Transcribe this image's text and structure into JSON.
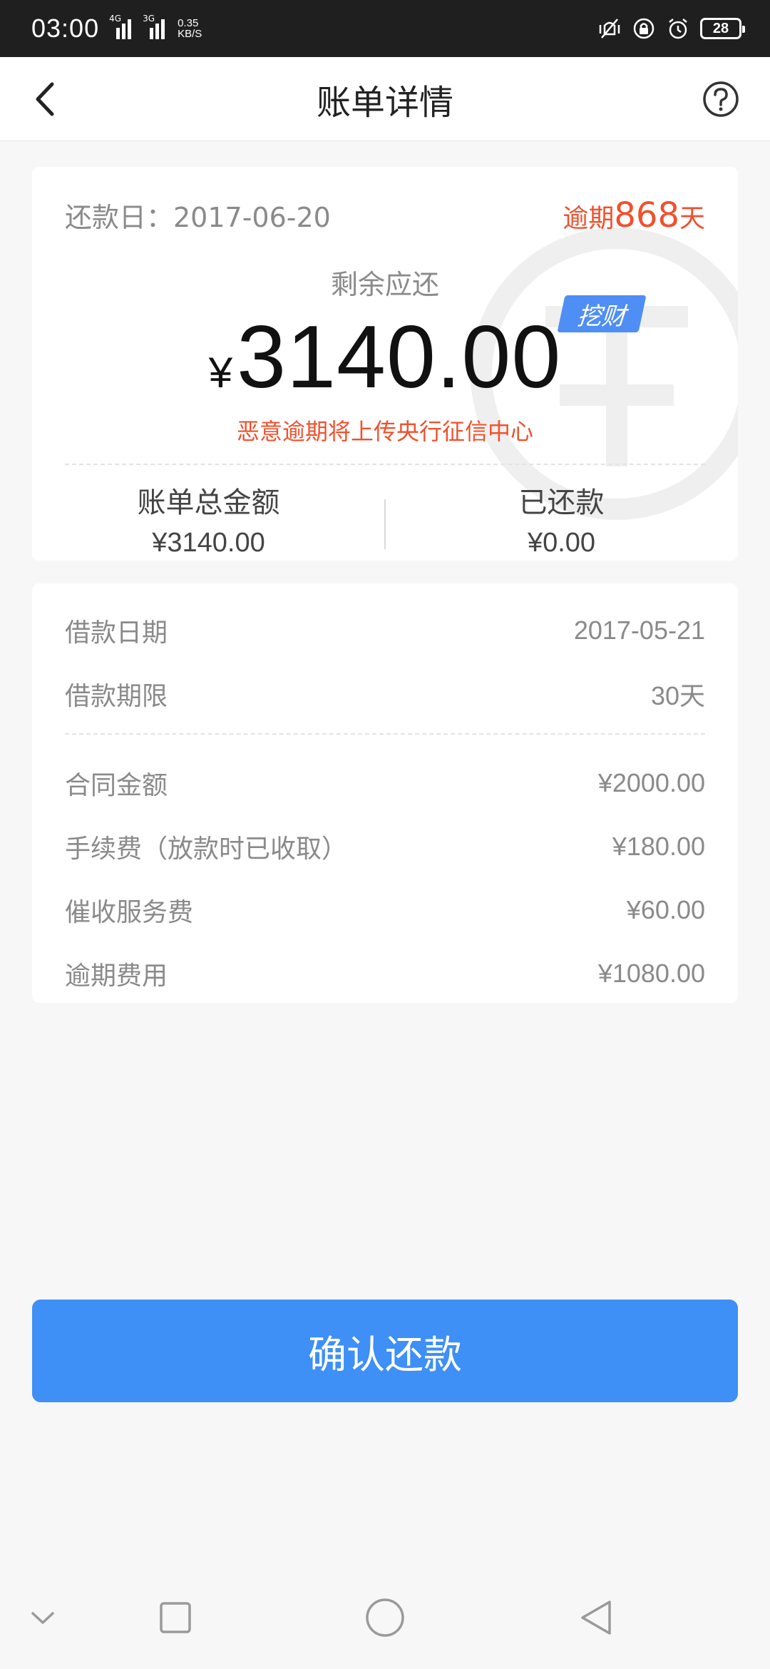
{
  "status_bar": {
    "time": "03:00",
    "net1_label": "4G",
    "net2_label": "3G",
    "speed_value": "0.35",
    "speed_unit": "KB/S",
    "battery": "28"
  },
  "header": {
    "title": "账单详情"
  },
  "summary": {
    "due_date": "还款日：2017-06-20",
    "overdue_prefix": "逾期",
    "overdue_days": "868",
    "overdue_suffix": "天",
    "remaining_label": "剩余应还",
    "currency": "¥",
    "amount": "3140.00",
    "tag": "挖财",
    "warning": "恶意逾期将上传央行征信中心",
    "total_label": "账单总金额",
    "total_value": "¥3140.00",
    "paid_label": "已还款",
    "paid_value": "¥0.00"
  },
  "details": {
    "rows": [
      {
        "label": "借款日期",
        "value": "2017-05-21"
      },
      {
        "label": "借款期限",
        "value": "30天"
      },
      {
        "label": "合同金额",
        "value": "¥2000.00"
      },
      {
        "label": "手续费（放款时已收取）",
        "value": "¥180.00"
      },
      {
        "label": "催收服务费",
        "value": "¥60.00"
      },
      {
        "label": "逾期费用",
        "value": "¥1080.00"
      }
    ]
  },
  "actions": {
    "confirm_label": "确认还款"
  },
  "icons": {
    "back": "chevron-left-icon",
    "help": "question-circle-icon",
    "nav_down": "chevron-down-icon",
    "nav_recent": "square-icon",
    "nav_home": "circle-icon",
    "nav_back": "triangle-back-icon"
  },
  "colors": {
    "accent": "#3e8ff6",
    "warning": "#f0502d",
    "tag": "#4f8ef5",
    "status_bar": "#1f1f1f"
  }
}
